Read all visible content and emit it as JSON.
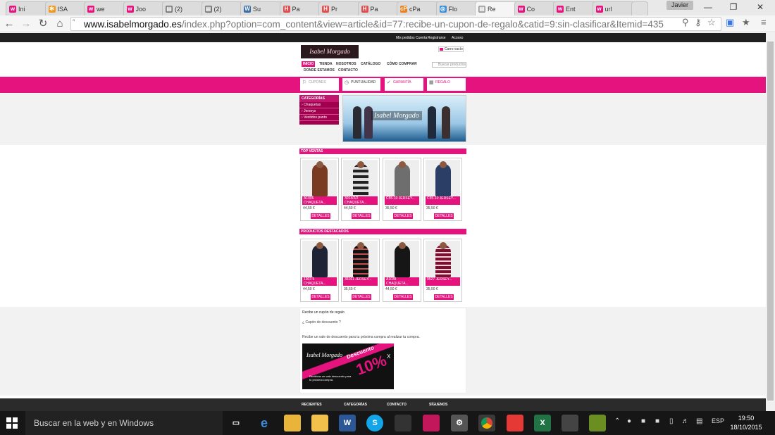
{
  "browser": {
    "tabs": [
      {
        "title": "Ini",
        "icon": "w-icon",
        "color": "#e5137e"
      },
      {
        "title": "ISA",
        "icon": "joomla-icon",
        "color": "#f29a1f"
      },
      {
        "title": "we",
        "icon": "w-icon",
        "color": "#e5137e"
      },
      {
        "title": "Joo",
        "icon": "w-icon",
        "color": "#e5137e"
      },
      {
        "title": "(2)",
        "icon": "page-icon",
        "color": "#777777"
      },
      {
        "title": "(2)",
        "icon": "page-icon",
        "color": "#777777"
      },
      {
        "title": "Su",
        "icon": "wp-icon",
        "color": "#3a6ea5"
      },
      {
        "title": "Pa",
        "icon": "h-icon",
        "color": "#e34c4c"
      },
      {
        "title": "Pr",
        "icon": "h-icon",
        "color": "#e34c4c"
      },
      {
        "title": "Pa",
        "icon": "h-icon",
        "color": "#e34c4c"
      },
      {
        "title": "cPa",
        "icon": "cpanel-icon",
        "color": "#f07f1b"
      },
      {
        "title": "Flo",
        "icon": "flow-icon",
        "color": "#3a8fd6"
      },
      {
        "title": "Re",
        "icon": "page-icon",
        "color": "#999999"
      },
      {
        "title": "Co",
        "icon": "w-icon",
        "color": "#e5137e"
      },
      {
        "title": "Ent",
        "icon": "w-icon",
        "color": "#e5137e"
      },
      {
        "title": "url",
        "icon": "w-icon",
        "color": "#e5137e"
      }
    ],
    "active_tab_index": 12,
    "profile_name": "Javier",
    "url_host": "www.isabelmorgado.es",
    "url_path": "/index.php?option=com_content&view=article&id=77:recibe-un-cupon-de-regalo&catid=9:sin-clasificar&Itemid=435"
  },
  "site": {
    "top_links": [
      "Mis pedidos",
      "Cuenta",
      "Registrarse",
      "Acceso"
    ],
    "logo_text": "Isabel Morgado",
    "cart_label": "Carro vacío",
    "menu": [
      "INICIO",
      "TIENDA",
      "NOSOTROS",
      "CATÁLOGO",
      "CÓMO COMPRAR",
      "DONDE ESTAMOS",
      "CONTACTO"
    ],
    "search_placeholder": "Buscar productos",
    "features": [
      "CUPONES",
      "PUNTUALIDAD",
      "GARANTÍA",
      "REGALO"
    ],
    "categories_title": "CATEGORÍAS",
    "categories": [
      "Chaquetas",
      "Jerseys",
      "Vestidos punto"
    ],
    "banner_logo": "Isabel Morgado",
    "top_sales_title": "TOP VENTAS",
    "top_sales": [
      {
        "name": "A1006 CHAQUETA...",
        "price": "44,50 €",
        "button": "DETALLES"
      },
      {
        "name": "3014/2/2 CHAQUETA...",
        "price": "44,50 €",
        "button": "DETALLES"
      },
      {
        "name": "C55-10 JERSEY...",
        "price": "35,50 €",
        "button": "DETALLES"
      },
      {
        "name": "C55-10 JERSEY...",
        "price": "35,50 €",
        "button": "DETALLES"
      }
    ],
    "featured_title": "PRODUCTOS DESTACADOS",
    "featured": [
      {
        "name": "1303 5 CHAQUETA...",
        "price": "44,50 €",
        "button": "DETALLES"
      },
      {
        "name": "36161 JERSEY...",
        "price": "35,50 €",
        "button": "DETALLES"
      },
      {
        "name": "A1038 CHAQUETA...",
        "price": "44,50 €",
        "button": "DETALLES"
      },
      {
        "name": "9527 JERSEY...",
        "price": "35,50 €",
        "button": "DETALLES"
      }
    ],
    "article": {
      "title": "Recibe un cupón de regalo",
      "question": "¿ Cupón de descuento ?",
      "text": "Recibe un vale de descuento para tu próxima compra al realizar tu compra.",
      "coupon_logo": "Isabel Morgado",
      "coupon_word": "Descuento",
      "coupon_percent": "10%",
      "coupon_x": "X",
      "coupon_small": "Recibirás un vale descuento para tu próxima compra."
    },
    "footer": [
      "RECIENTES",
      "CATEGORÍAS",
      "CONTACTO",
      "SÍGUENOS"
    ]
  },
  "taskbar": {
    "search_placeholder": "Buscar en la web y en Windows",
    "language": "ESP",
    "time": "19:50",
    "date": "18/10/2015"
  },
  "colors": {
    "brand_pink": "#e5137e",
    "dark": "#161616"
  }
}
